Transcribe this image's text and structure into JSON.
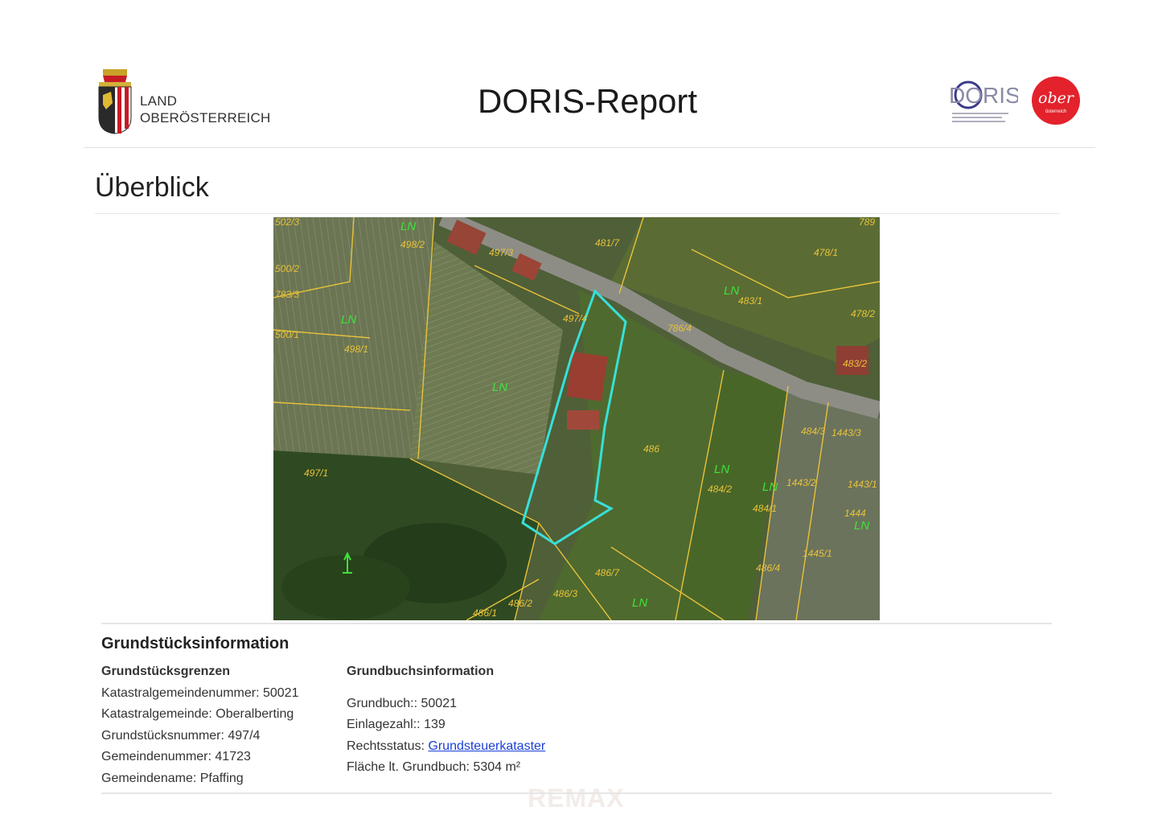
{
  "header": {
    "land_line1": "LAND",
    "land_line2": "OBERÖSTERREICH",
    "title": "DORIS-Report",
    "doris_logo_text": "DORIS",
    "ooe_logo_text": "ober",
    "ooe_logo_subtext": "österreich"
  },
  "overview": {
    "title": "Überblick",
    "map": {
      "parcels": [
        "502/3",
        "498/2",
        "500/2",
        "783/3",
        "500/1",
        "498/1",
        "497/1",
        "497/3",
        "497/4",
        "481/7",
        "478/1",
        "483/1",
        "786/4",
        "478/2",
        "483/2",
        "486",
        "484/2",
        "484/1",
        "484/3",
        "1443/3",
        "1443/2",
        "1443/1",
        "1444",
        "1445/1",
        "486/4",
        "486/7",
        "486/3",
        "486/2",
        "486/1",
        "789"
      ],
      "land_use_labels": [
        "LN",
        "LN",
        "LN",
        "LN",
        "LN",
        "LN",
        "LN",
        "LN"
      ],
      "colors": {
        "parcel_line": "#e8c23a",
        "selection": "#38e0d8",
        "land_use_text": "#3ee23a",
        "fields": "#5c6a3e",
        "forest": "#2e4a22"
      }
    }
  },
  "info": {
    "title": "Grundstücksinformation",
    "left": {
      "heading": "Grundstücksgrenzen",
      "rows": [
        "Katastralgemeindenummer: 50021",
        "Katastralgemeinde: Oberalberting",
        "Grundstücksnummer: 497/4",
        "Gemeindenummer: 41723",
        "Gemeindename: Pfaffing"
      ]
    },
    "right": {
      "heading": "Grundbuchsinformation",
      "grundbuch": "Grundbuch:: 50021",
      "einlagezahl": "Einlagezahl:: 139",
      "rechtsstatus_label": "Rechtsstatus:",
      "rechtsstatus_link": "Grundsteuerkataster",
      "flaeche": "Fläche lt. Grundbuch: 5304 m²"
    }
  },
  "watermark": "REMAX"
}
